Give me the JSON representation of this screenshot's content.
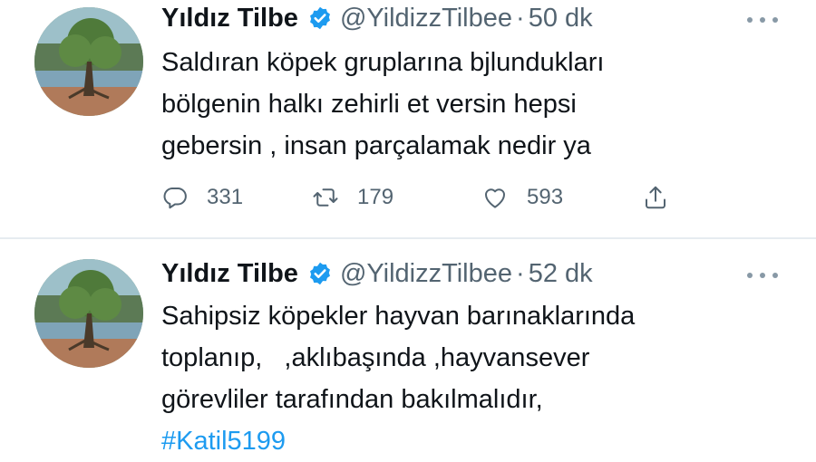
{
  "tweets": [
    {
      "author_name": "Yıldız Tilbe",
      "handle": "@YildizzTilbee",
      "separator": "·",
      "time": "50 dk",
      "lines": [
        "Saldıran köpek gruplarına bjlundukları",
        "bölgenin halkı zehirli et versin hepsi",
        "gebersin , insan parçalamak nedir ya"
      ],
      "reply_count": "331",
      "retweet_count": "179",
      "like_count": "593"
    },
    {
      "author_name": "Yıldız Tilbe",
      "handle": "@YildizzTilbee",
      "separator": "·",
      "time": "52 dk",
      "lines": [
        "Sahipsiz köpekler hayvan barınaklarında",
        "toplanıp,   ,aklıbaşında ,hayvansever",
        "görevliler tarafından bakılmalıdır,"
      ],
      "hashtag": "#Katil5199"
    }
  ],
  "icons": {
    "verified": "verified-badge-icon",
    "more": "more-options-icon",
    "reply": "reply-icon",
    "retweet": "retweet-icon",
    "like": "heart-icon",
    "share": "share-icon"
  },
  "colors": {
    "verified_blue": "#1d9bf0",
    "hashtag_blue": "#1d9bf0",
    "secondary_text": "#536471",
    "divider": "#e6ecf0"
  }
}
